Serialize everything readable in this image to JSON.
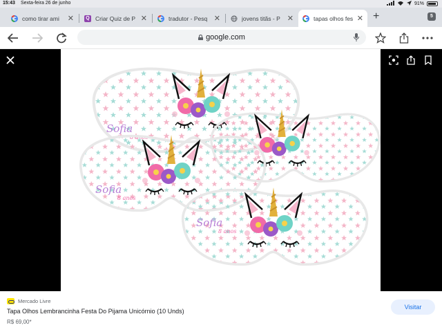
{
  "status_bar": {
    "time": "15:43",
    "date": "Sexta-feira 26 de junho",
    "battery": "91%"
  },
  "tabs": [
    {
      "label": "como tirar ami",
      "favicon": "google-icon",
      "active": false
    },
    {
      "label": "Criar Quiz de P",
      "favicon": "quiz-icon",
      "active": false
    },
    {
      "label": "tradutor - Pesq",
      "favicon": "google-icon",
      "active": false
    },
    {
      "label": "jovens titãs - P",
      "favicon": "globe-icon",
      "active": false
    },
    {
      "label": "tapas olhos fes",
      "favicon": "google-icon",
      "active": true
    }
  ],
  "tab_count": "5",
  "omnibox": {
    "url": "google.com"
  },
  "image": {
    "mask_text_name": "Sofia",
    "mask_text_age": "8 anos",
    "colors": {
      "pink": "#f06ba8",
      "purple": "#9b59c8",
      "teal": "#6fd3c6",
      "gold": "#e2b13c",
      "star_pink": "#f4b6c8",
      "star_teal": "#a6dcd6"
    }
  },
  "result": {
    "source": "Mercado Livre",
    "title": "Tapa Olhos Lembrancinha Festa Do Pijama Unicórnio (10 Unds)",
    "price": "R$ 69,00*",
    "visit_label": "Visitar"
  }
}
